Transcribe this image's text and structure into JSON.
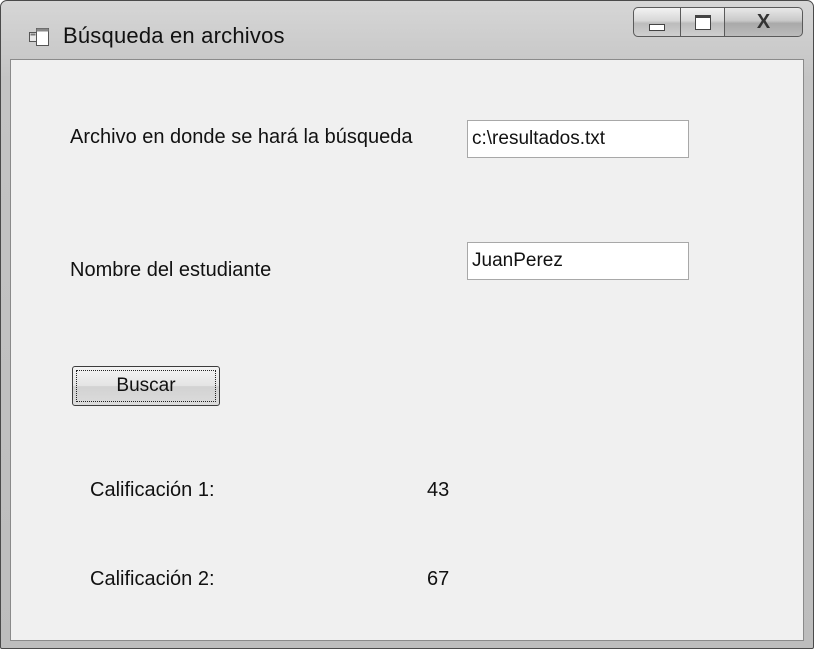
{
  "window": {
    "title": "Búsqueda en archivos",
    "minimize_icon": "minimize-icon",
    "maximize_icon": "maximize-icon",
    "close_glyph": "X"
  },
  "form": {
    "file_label": "Archivo en donde se hará la búsqueda",
    "file_value": "c:\\resultados.txt",
    "student_label": "Nombre del estudiante",
    "student_value": "JuanPerez",
    "search_button": "Buscar",
    "grade1_label": "Calificación 1:",
    "grade1_value": "43",
    "grade2_label": "Calificación 2:",
    "grade2_value": "67"
  },
  "colors": {
    "client_background": "#f0f0f0",
    "frame": "#c4c4c4"
  }
}
